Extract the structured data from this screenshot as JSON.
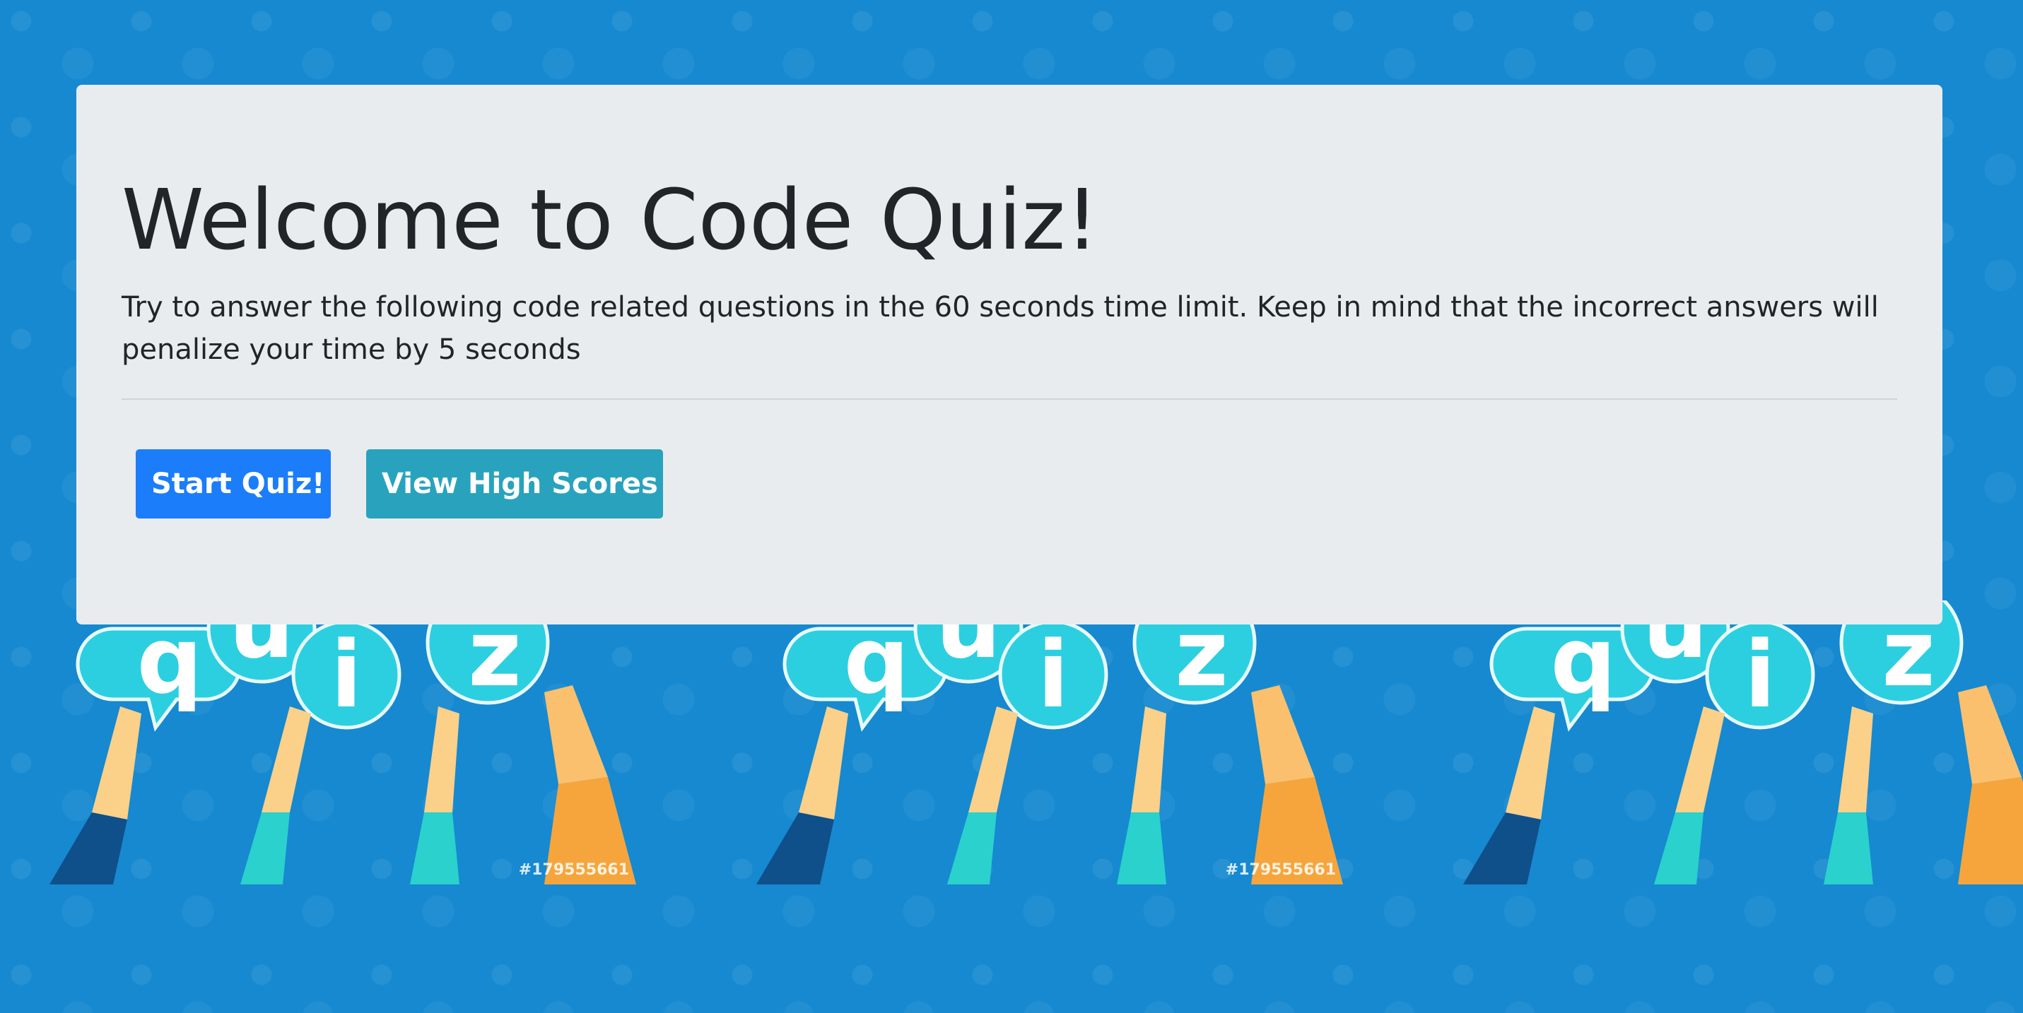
{
  "page": {
    "title": "Welcome to Code Quiz!",
    "lead": "Try to answer the following code related questions in the 60 seconds time limit. Keep in mind that the incorrect answers will penalize your time by 5 seconds"
  },
  "buttons": {
    "start_label": "Start Quiz!",
    "scores_label": "View High Scores"
  },
  "background": {
    "image_id": "#179555661",
    "letters": [
      "q",
      "u",
      "i",
      "z"
    ]
  },
  "colors": {
    "page_background": "#1689d0",
    "card_background": "#e9ecef",
    "primary_button": "#1b7dfa",
    "info_button": "#29a3bd",
    "bubble": "#2ccfe0"
  }
}
